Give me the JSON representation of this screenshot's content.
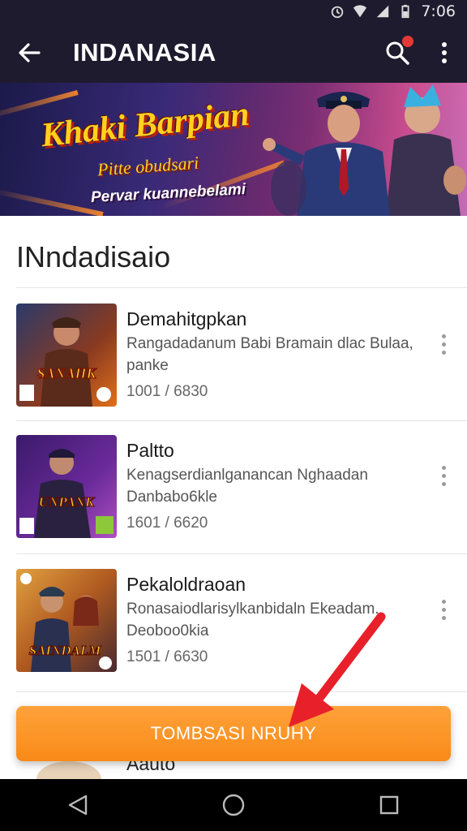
{
  "status_bar": {
    "time": "7:06"
  },
  "app_bar": {
    "title": "INDANASIA"
  },
  "banner": {
    "title": "Khaki Barpian",
    "subtitle": "Pitte obudsari",
    "tagline": "Pervar kuannebelami"
  },
  "section": {
    "title": "INndadisaio"
  },
  "items": [
    {
      "title": "Demahitgpkan",
      "description": "Rangadadanum Babi Bramain dlac Bulaa, panke",
      "meta": "1001 / 6830"
    },
    {
      "title": "Paltto",
      "description": "Kenagserdianlganancan Nghaadan Danbabo6kle",
      "meta": "1601 / 6620"
    },
    {
      "title": "Pekaloldraoan",
      "description": "Ronasaiodlarisylkanbidaln Ekeadam. Deoboo0kia",
      "meta": "1501 / 6630"
    }
  ],
  "peek_item": {
    "title": "Aauto"
  },
  "cta": {
    "label": "TOMBSASI NRUHY"
  },
  "icons": {
    "back": "arrow-left-icon",
    "search": "search-icon",
    "more": "more-vert-icon",
    "nav_back": "triangle-back-icon",
    "nav_home": "circle-home-icon",
    "nav_recents": "square-recents-icon"
  },
  "colors": {
    "app_bar": "#1f1b2e",
    "accent": "#f98a18",
    "notification": "#e53935",
    "arrow": "#e8202a"
  }
}
